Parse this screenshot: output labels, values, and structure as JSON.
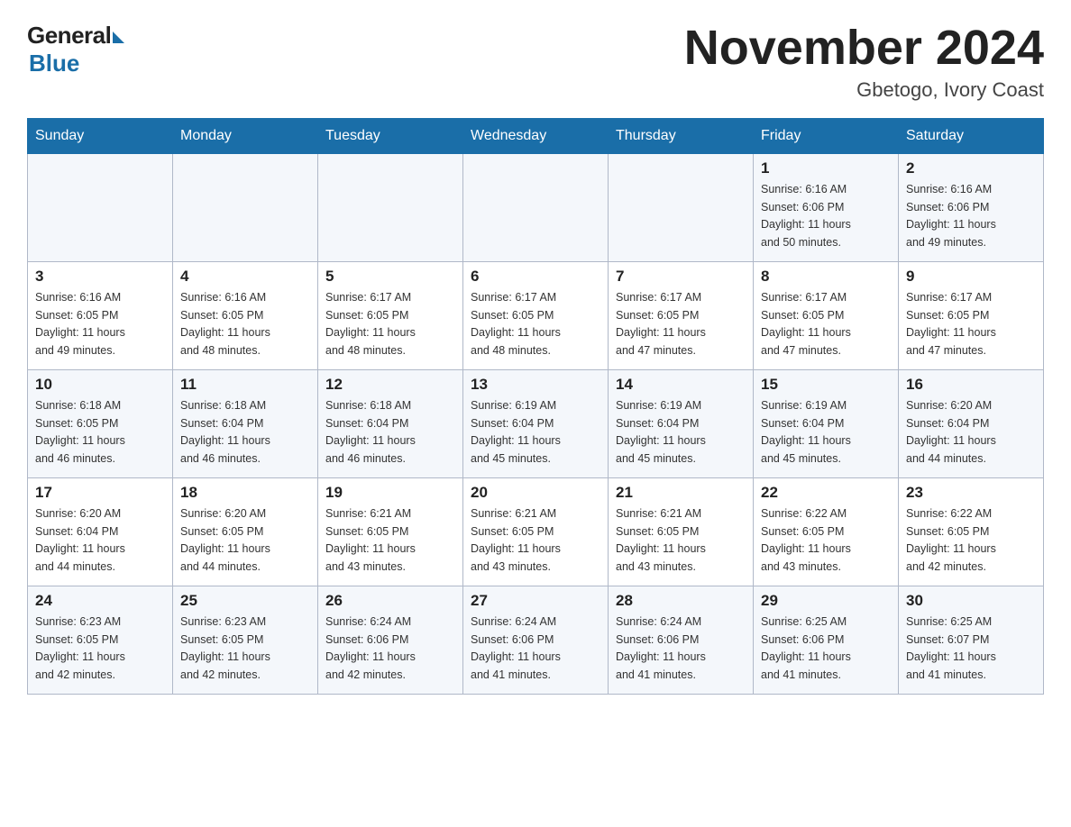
{
  "header": {
    "logo_general": "General",
    "logo_blue": "Blue",
    "month_title": "November 2024",
    "location": "Gbetogo, Ivory Coast"
  },
  "days_of_week": [
    "Sunday",
    "Monday",
    "Tuesday",
    "Wednesday",
    "Thursday",
    "Friday",
    "Saturday"
  ],
  "weeks": [
    [
      {
        "day": "",
        "info": ""
      },
      {
        "day": "",
        "info": ""
      },
      {
        "day": "",
        "info": ""
      },
      {
        "day": "",
        "info": ""
      },
      {
        "day": "",
        "info": ""
      },
      {
        "day": "1",
        "info": "Sunrise: 6:16 AM\nSunset: 6:06 PM\nDaylight: 11 hours\nand 50 minutes."
      },
      {
        "day": "2",
        "info": "Sunrise: 6:16 AM\nSunset: 6:06 PM\nDaylight: 11 hours\nand 49 minutes."
      }
    ],
    [
      {
        "day": "3",
        "info": "Sunrise: 6:16 AM\nSunset: 6:05 PM\nDaylight: 11 hours\nand 49 minutes."
      },
      {
        "day": "4",
        "info": "Sunrise: 6:16 AM\nSunset: 6:05 PM\nDaylight: 11 hours\nand 48 minutes."
      },
      {
        "day": "5",
        "info": "Sunrise: 6:17 AM\nSunset: 6:05 PM\nDaylight: 11 hours\nand 48 minutes."
      },
      {
        "day": "6",
        "info": "Sunrise: 6:17 AM\nSunset: 6:05 PM\nDaylight: 11 hours\nand 48 minutes."
      },
      {
        "day": "7",
        "info": "Sunrise: 6:17 AM\nSunset: 6:05 PM\nDaylight: 11 hours\nand 47 minutes."
      },
      {
        "day": "8",
        "info": "Sunrise: 6:17 AM\nSunset: 6:05 PM\nDaylight: 11 hours\nand 47 minutes."
      },
      {
        "day": "9",
        "info": "Sunrise: 6:17 AM\nSunset: 6:05 PM\nDaylight: 11 hours\nand 47 minutes."
      }
    ],
    [
      {
        "day": "10",
        "info": "Sunrise: 6:18 AM\nSunset: 6:05 PM\nDaylight: 11 hours\nand 46 minutes."
      },
      {
        "day": "11",
        "info": "Sunrise: 6:18 AM\nSunset: 6:04 PM\nDaylight: 11 hours\nand 46 minutes."
      },
      {
        "day": "12",
        "info": "Sunrise: 6:18 AM\nSunset: 6:04 PM\nDaylight: 11 hours\nand 46 minutes."
      },
      {
        "day": "13",
        "info": "Sunrise: 6:19 AM\nSunset: 6:04 PM\nDaylight: 11 hours\nand 45 minutes."
      },
      {
        "day": "14",
        "info": "Sunrise: 6:19 AM\nSunset: 6:04 PM\nDaylight: 11 hours\nand 45 minutes."
      },
      {
        "day": "15",
        "info": "Sunrise: 6:19 AM\nSunset: 6:04 PM\nDaylight: 11 hours\nand 45 minutes."
      },
      {
        "day": "16",
        "info": "Sunrise: 6:20 AM\nSunset: 6:04 PM\nDaylight: 11 hours\nand 44 minutes."
      }
    ],
    [
      {
        "day": "17",
        "info": "Sunrise: 6:20 AM\nSunset: 6:04 PM\nDaylight: 11 hours\nand 44 minutes."
      },
      {
        "day": "18",
        "info": "Sunrise: 6:20 AM\nSunset: 6:05 PM\nDaylight: 11 hours\nand 44 minutes."
      },
      {
        "day": "19",
        "info": "Sunrise: 6:21 AM\nSunset: 6:05 PM\nDaylight: 11 hours\nand 43 minutes."
      },
      {
        "day": "20",
        "info": "Sunrise: 6:21 AM\nSunset: 6:05 PM\nDaylight: 11 hours\nand 43 minutes."
      },
      {
        "day": "21",
        "info": "Sunrise: 6:21 AM\nSunset: 6:05 PM\nDaylight: 11 hours\nand 43 minutes."
      },
      {
        "day": "22",
        "info": "Sunrise: 6:22 AM\nSunset: 6:05 PM\nDaylight: 11 hours\nand 43 minutes."
      },
      {
        "day": "23",
        "info": "Sunrise: 6:22 AM\nSunset: 6:05 PM\nDaylight: 11 hours\nand 42 minutes."
      }
    ],
    [
      {
        "day": "24",
        "info": "Sunrise: 6:23 AM\nSunset: 6:05 PM\nDaylight: 11 hours\nand 42 minutes."
      },
      {
        "day": "25",
        "info": "Sunrise: 6:23 AM\nSunset: 6:05 PM\nDaylight: 11 hours\nand 42 minutes."
      },
      {
        "day": "26",
        "info": "Sunrise: 6:24 AM\nSunset: 6:06 PM\nDaylight: 11 hours\nand 42 minutes."
      },
      {
        "day": "27",
        "info": "Sunrise: 6:24 AM\nSunset: 6:06 PM\nDaylight: 11 hours\nand 41 minutes."
      },
      {
        "day": "28",
        "info": "Sunrise: 6:24 AM\nSunset: 6:06 PM\nDaylight: 11 hours\nand 41 minutes."
      },
      {
        "day": "29",
        "info": "Sunrise: 6:25 AM\nSunset: 6:06 PM\nDaylight: 11 hours\nand 41 minutes."
      },
      {
        "day": "30",
        "info": "Sunrise: 6:25 AM\nSunset: 6:07 PM\nDaylight: 11 hours\nand 41 minutes."
      }
    ]
  ]
}
